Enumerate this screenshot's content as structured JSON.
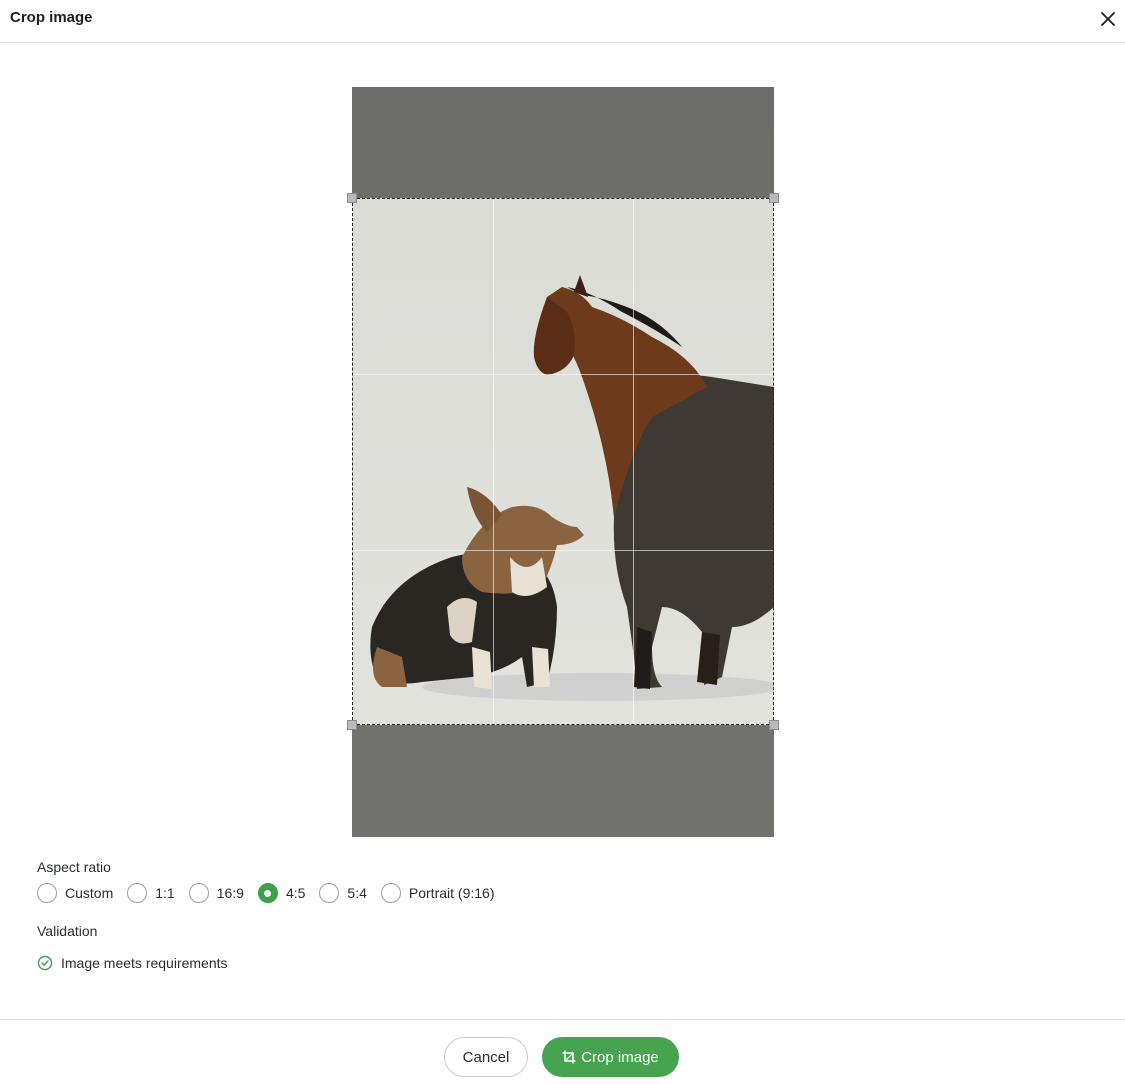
{
  "dialog": {
    "title": "Crop image",
    "close_icon": "close-icon"
  },
  "image": {
    "description_icon": "photo-preview",
    "aspect_selected": "4:5"
  },
  "aspect_ratio": {
    "label": "Aspect ratio",
    "options": [
      {
        "label": "Custom",
        "checked": false
      },
      {
        "label": "1:1",
        "checked": false
      },
      {
        "label": "16:9",
        "checked": false
      },
      {
        "label": "4:5",
        "checked": true
      },
      {
        "label": "5:4",
        "checked": false
      },
      {
        "label": "Portrait (9:16)",
        "checked": false
      }
    ]
  },
  "validation": {
    "label": "Validation",
    "message": "Image meets requirements",
    "status_color": "#3f9f4a"
  },
  "footer": {
    "cancel_label": "Cancel",
    "crop_label": "Crop image",
    "accent": "#46a450"
  }
}
